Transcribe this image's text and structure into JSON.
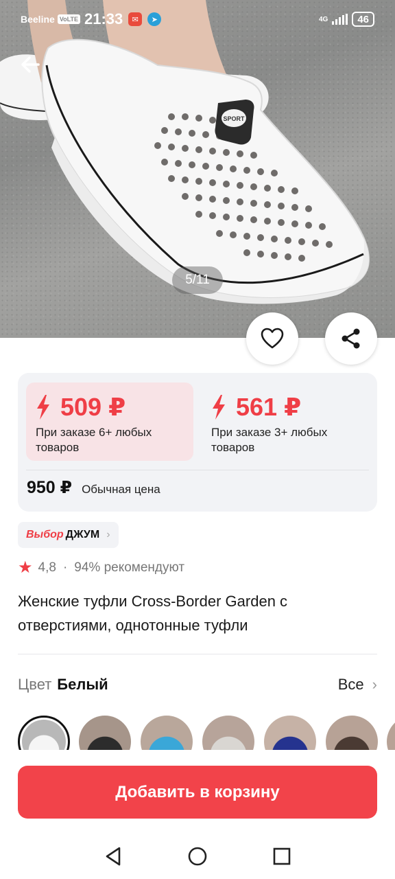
{
  "status_bar": {
    "carrier": "Beeline",
    "volte": "VoLTE",
    "time": "21:33",
    "network": "4G",
    "battery": "46"
  },
  "gallery": {
    "counter": "5/11",
    "shoe_badge": "SPORT"
  },
  "price": {
    "tiers": [
      {
        "amount": "509 ₽",
        "condition": "При заказе 6+ любых товаров"
      },
      {
        "amount": "561 ₽",
        "condition": "При заказе 3+ любых товаров"
      }
    ],
    "regular_value": "950 ₽",
    "regular_label": "Обычная цена"
  },
  "choice_badge": {
    "brand_italic": "Выбор",
    "brand_bold": "ДЖУМ"
  },
  "rating": {
    "value": "4,8",
    "recommend": "94% рекомендуют"
  },
  "product_title": "Женские туфли Cross-Border Garden с отверстиями, однотонные туфли",
  "color_section": {
    "label": "Цвет",
    "value": "Белый",
    "all": "Все"
  },
  "swatch_colors": [
    "#e9e9e9",
    "#2c2c2c",
    "#3aa7d8",
    "#d9d6d2",
    "#25338f",
    "#4a3a33",
    "#8a7d6d"
  ],
  "cart_button": "Добавить в корзину",
  "colors": {
    "accent": "#f2434a",
    "price_red": "#ef3e46",
    "tier_bg": "#f8e3e6",
    "card_bg": "#f2f3f6"
  }
}
